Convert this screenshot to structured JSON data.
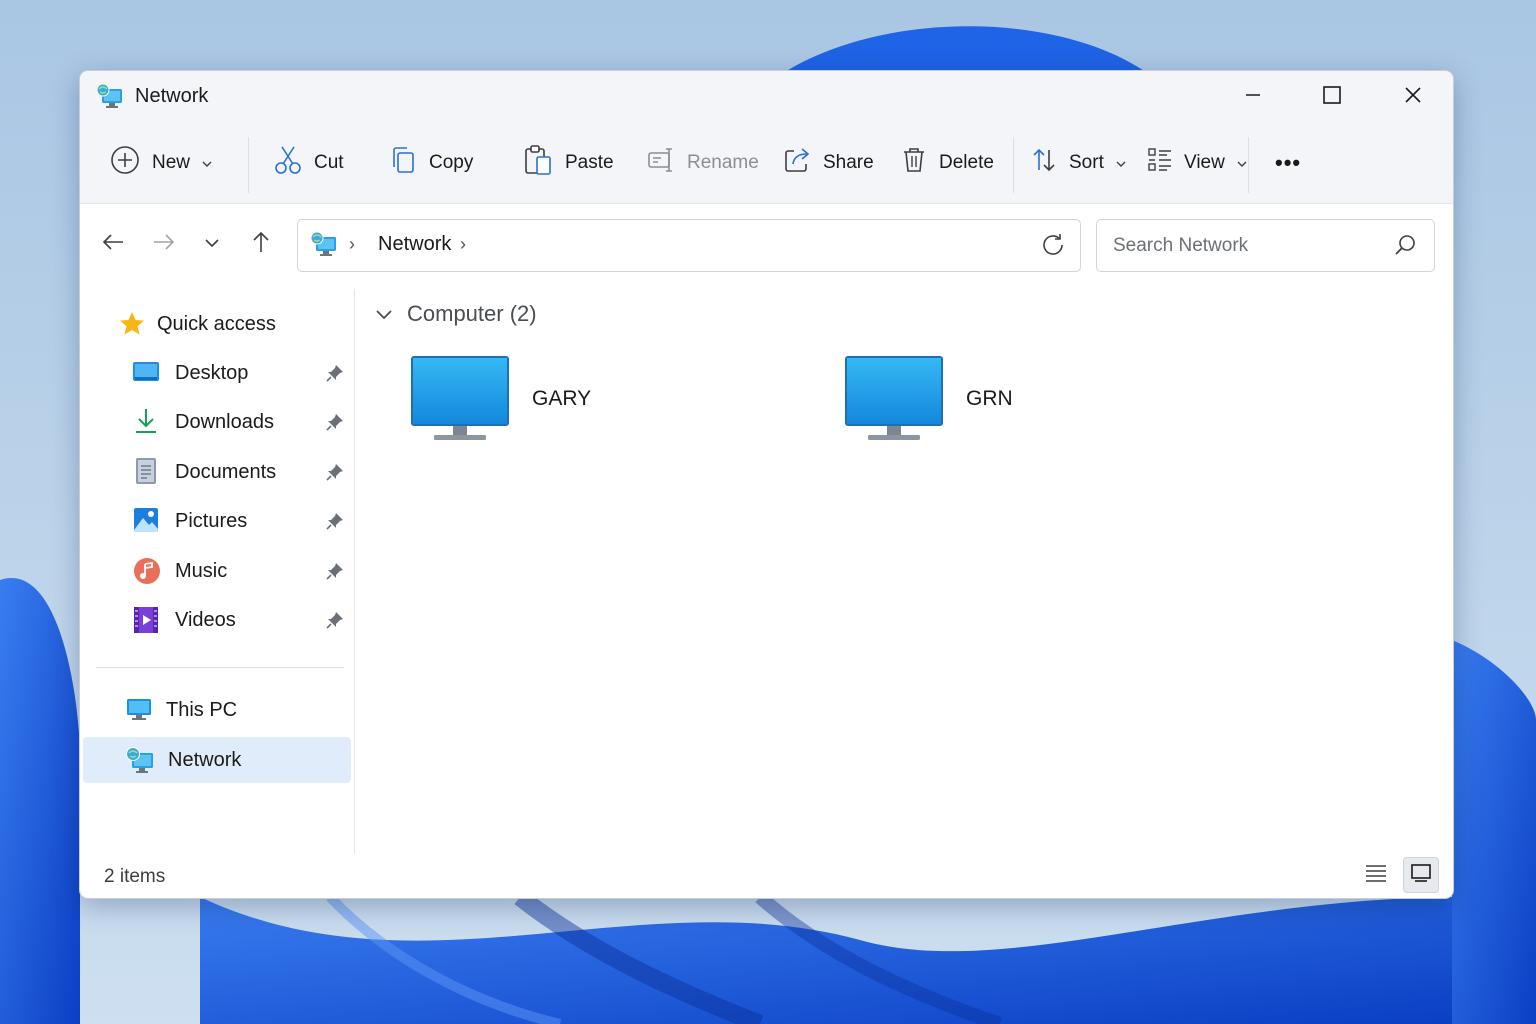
{
  "window": {
    "title": "Network"
  },
  "titlebar_buttons": {
    "minimize": "minimize-icon",
    "maximize": "maximize-icon",
    "close": "close-icon"
  },
  "toolbar": {
    "new_label": "New",
    "cut_label": "Cut",
    "copy_label": "Copy",
    "paste_label": "Paste",
    "rename_label": "Rename",
    "share_label": "Share",
    "delete_label": "Delete",
    "sort_label": "Sort",
    "view_label": "View",
    "more_label": "•••"
  },
  "address": {
    "crumb": "Network",
    "separator": "›"
  },
  "search": {
    "placeholder": "Search Network",
    "value": ""
  },
  "sidebar": {
    "quick_access": "Quick access",
    "items": [
      {
        "label": "Desktop",
        "icon": "desktop-folder-icon",
        "pinned": true
      },
      {
        "label": "Downloads",
        "icon": "downloads-folder-icon",
        "pinned": true
      },
      {
        "label": "Documents",
        "icon": "documents-folder-icon",
        "pinned": true
      },
      {
        "label": "Pictures",
        "icon": "pictures-folder-icon",
        "pinned": true
      },
      {
        "label": "Music",
        "icon": "music-folder-icon",
        "pinned": true
      },
      {
        "label": "Videos",
        "icon": "videos-folder-icon",
        "pinned": true
      }
    ],
    "this_pc": "This PC",
    "network": "Network",
    "selected": "Network"
  },
  "content": {
    "group_label": "Computer (2)",
    "computers": [
      {
        "name": "GARY",
        "icon": "monitor-icon"
      },
      {
        "name": "GRN",
        "icon": "monitor-icon"
      }
    ]
  },
  "status": {
    "count": "2 items",
    "active_view": "tiles"
  },
  "colors": {
    "accent": "#0f6cbd",
    "selection": "#e0ecfa",
    "chrome": "#f3f5f9"
  }
}
